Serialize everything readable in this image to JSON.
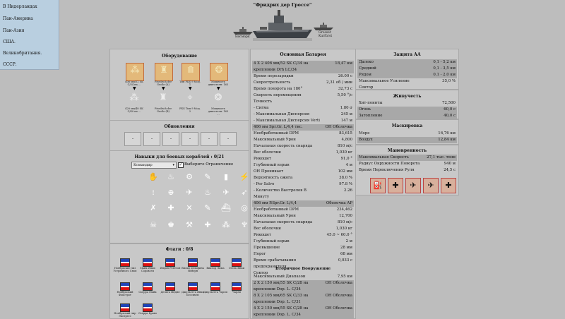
{
  "nav": [
    "В Нидерландах",
    "Пан-Америка",
    "Пан-Азия",
    "США.",
    "Великобритания.",
    "СССР."
  ],
  "ship": {
    "title": "\"Фридрих дер Гроссе\"",
    "left_label": "Бисмарк",
    "right_label": "Grosser Kurfürst"
  },
  "equipment": {
    "title": "Оборудование",
    "top": [
      {
        "icon": "main-battery-icon",
        "caption": "406 мм/52 SK C/34 на ..."
      },
      {
        "icon": "hull-icon",
        "caption": "Friedrich der Große (A)"
      },
      {
        "icon": "torpedo-icon",
        "caption": "Тип FKS 9 Мод. 1"
      },
      {
        "icon": "engine-icon",
        "caption": "Мощность двигателя: 163 ..."
      }
    ],
    "bottom": [
      {
        "icon": "main-battery-icon",
        "caption": "420 мм/48 SK C/40 на ..."
      },
      {
        "icon": "hull-icon",
        "caption": "Friedrich der Große (B)"
      },
      {
        "icon": "fire-control-icon",
        "caption": "FKS Тип 9 Мод. 2"
      },
      {
        "icon": "engine-icon",
        "caption": "Мощность двигателя: 163 ..."
      }
    ]
  },
  "upgrades": {
    "title": "Обновления",
    "slots": [
      "-",
      "-",
      "-",
      "-",
      "-",
      "-"
    ]
  },
  "skills": {
    "title": "Навыки для боевых кораблей : 0/21",
    "select": "Командир",
    "checkbox_label": "Выберите Ограничение"
  },
  "flags": {
    "title": "Флаги : 0/8",
    "items": [
      "Ноябрьские лиз Устричного Сноп",
      "Майк Янки Соровэлл",
      "Индия Рентгон",
      "Виски Дельфина Неверн",
      "Виктор Лима",
      "Отель Янки",
      "Ноябрьский Фокстрот",
      "Сьерра Майк",
      "Дельта Индия",
      "Джульетта Янки Бессимлс",
      "Джульетта Чарли",
      "Чарли",
      "Ноябрьский лир Экспресс",
      "Сьерра Браво"
    ]
  },
  "main_battery": {
    "title": "Основная Батарея",
    "rows": [
      {
        "k": "4 X 2 406 мм/52 SK C/34 на",
        "v": "18,47 км",
        "shade": true
      },
      {
        "k": "креплении Drh LC/34",
        "v": "",
        "shade": true
      },
      {
        "k": "Время перезарядки",
        "v": "26.00 c",
        "shade": false
      },
      {
        "k": "Скорострельность",
        "v": "2,31 об / мин",
        "shade": false
      },
      {
        "k": "Время поворота на 180°",
        "v": "32,73 c",
        "shade": false
      },
      {
        "k": "Скорость перемещения",
        "v": "5,50 °/с",
        "shade": false
      },
      {
        "k": "Точность",
        "v": "",
        "shade": false
      },
      {
        "k": "- Сигма",
        "v": "1.80 σ",
        "shade": false
      },
      {
        "k": "- Максимальная Дисперсия",
        "v": "245 м",
        "shade": false
      },
      {
        "k": "- Максимальная Дисперсия Verti",
        "v": "147 м",
        "shade": false
      },
      {
        "k": "406 мм Spr.Gr. L/4,4 тнс.",
        "v": "ОН Оболочка",
        "shade": true
      },
      {
        "k": "Необработанный DPM",
        "v": "83,615",
        "shade": false
      },
      {
        "k": "Максимальный Урон",
        "v": "4,800",
        "shade": false
      },
      {
        "k": "Начальная скорость снаряда",
        "v": "810 м/с",
        "shade": false
      },
      {
        "k": "Вес оболочки",
        "v": "1,030 кг",
        "shade": false
      },
      {
        "k": "Рикошет",
        "v": "91,0 °",
        "shade": false
      },
      {
        "k": "Глубинный взрыв",
        "v": "4 м",
        "shade": false
      },
      {
        "k": "ОН Проникает",
        "v": "102 мм",
        "shade": false
      },
      {
        "k": "Вероятность ожога",
        "v": "38.0 %",
        "shade": false
      },
      {
        "k": "- Per Salvo",
        "v": "97.8 %",
        "shade": false
      },
      {
        "k": "- Количество Выстрелов В",
        "v": "2.26",
        "shade": false
      },
      {
        "k": "Минуту",
        "v": "",
        "shade": false
      },
      {
        "k": "406 мм P.Spr.Gr. L/4,4",
        "v": "Оболочка АР",
        "shade": true
      },
      {
        "k": "Необработанный DPM",
        "v": "234,462",
        "shade": false
      },
      {
        "k": "Максимальный Урон",
        "v": "12,700",
        "shade": false
      },
      {
        "k": "Начальная скорость снаряда",
        "v": "810 м/с",
        "shade": false
      },
      {
        "k": "Вес оболочки",
        "v": "1,030 кг",
        "shade": false
      },
      {
        "k": "Рикошет",
        "v": "45.0 ~ 60.0 °",
        "shade": false
      },
      {
        "k": "Глубинный взрыв",
        "v": "2 м",
        "shade": false
      },
      {
        "k": "Превышение",
        "v": "28 мм",
        "shade": false
      },
      {
        "k": "Порог",
        "v": "68 мм",
        "shade": false
      },
      {
        "k": "Время срабатывания",
        "v": "0,033 c",
        "shade": false
      },
      {
        "k": "предохранителя",
        "v": "",
        "shade": false
      },
      {
        "k": "Сектор",
        "v": "",
        "shade": false
      }
    ]
  },
  "secondary": {
    "title": "Вторичное Вооружение",
    "rows": [
      {
        "k": "Максимальный Диапазон",
        "v": "7,95 км",
        "shade": false
      },
      {
        "k": "2 X 2 150 мм/55 SK C/28 на",
        "v": "ОН Оболочка",
        "shade": true
      },
      {
        "k": "креплении Dop. L. C/34",
        "v": "",
        "shade": true
      },
      {
        "k": "8 X 2 105 мм/65 SK C/33 на",
        "v": "ОН Оболочка",
        "shade": true
      },
      {
        "k": "креплении Dop. L. C/31",
        "v": "",
        "shade": true
      },
      {
        "k": "4 X 2 150 мм/55 SK C/28 на",
        "v": "ОН Оболочка",
        "shade": true
      },
      {
        "k": "креплении Dop. L. C/34",
        "v": "",
        "shade": true
      }
    ]
  },
  "aa": {
    "title": "Защита АА",
    "rows": [
      {
        "k": "Далеко",
        "v": "0,1 - 5,2 км",
        "shade": true
      },
      {
        "k": "Средний",
        "v": "0,1 - 3,5 км",
        "shade": true
      },
      {
        "k": "Рядом",
        "v": "0,1 - 2,0 км",
        "shade": true
      },
      {
        "k": "Максимальное Усиление",
        "v": "35,0 %",
        "shade": false
      },
      {
        "k": "Сектор",
        "v": "",
        "shade": false
      }
    ]
  },
  "survivability": {
    "title": "Живучесть",
    "rows": [
      {
        "k": "Хит-поинты",
        "v": "72,500",
        "shade": false
      },
      {
        "k": "Огонь",
        "v": "60,0 с",
        "shade": true
      },
      {
        "k": "Затопление",
        "v": "40,0 с",
        "shade": true
      }
    ]
  },
  "concealment": {
    "title": "Маскировка",
    "rows": [
      {
        "k": "Море",
        "v": "16,76 км",
        "shade": false
      },
      {
        "k": "Воздух",
        "v": "12,84 км",
        "shade": true
      }
    ]
  },
  "maneuverability": {
    "title": "Маневренность",
    "rows": [
      {
        "k": "Максимальная Скорость",
        "v": "27,1 тыс. тонн",
        "shade": true
      },
      {
        "k": "Радиус Окружности Поворота",
        "v": "940 м",
        "shade": false
      },
      {
        "k": "Время Переключения Руля",
        "v": "24,5 с",
        "shade": false
      }
    ],
    "modules": [
      "fuel-icon",
      "repair-icon",
      "fighter-icon",
      "spotter-plane-icon",
      "heal-icon"
    ]
  }
}
